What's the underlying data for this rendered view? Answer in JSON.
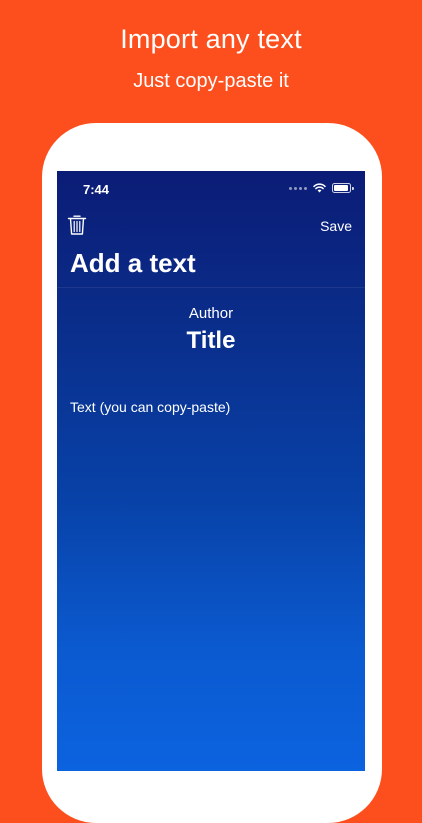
{
  "promo": {
    "headline": "Import any text",
    "subline": "Just copy-paste it"
  },
  "status_bar": {
    "time": "7:44",
    "icons": [
      "signal-icon",
      "wifi-icon",
      "battery-icon"
    ]
  },
  "nav": {
    "delete_icon": "trash-icon",
    "save_label": "Save",
    "title": "Add a text"
  },
  "form": {
    "author_placeholder": "Author",
    "title_placeholder": "Title",
    "text_placeholder": "Text (you can copy-paste)"
  },
  "colors": {
    "background": "#fd4f1e",
    "screen_top": "#0b1c76",
    "screen_bottom": "#0c63df",
    "text": "#ffffff"
  }
}
